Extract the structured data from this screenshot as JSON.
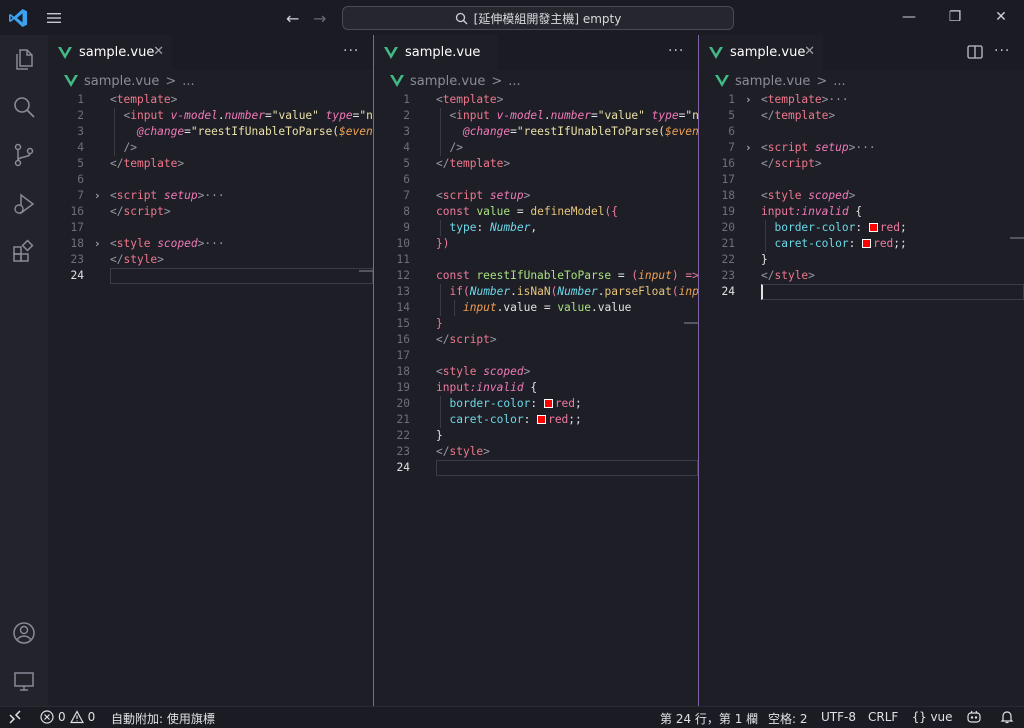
{
  "titlebar": {
    "command_center": "[延伸模組開發主機] empty",
    "back_arrow": "←",
    "forward_arrow": "→",
    "minimize": "—",
    "maximize": "❐",
    "close": "✕"
  },
  "colors": {
    "accent": "#7e63a8",
    "vue_green": "#42b883",
    "swatch_red": "#ff0000"
  },
  "activity_icons": [
    "files-icon",
    "search-icon",
    "source-control-icon",
    "run-debug-icon",
    "extensions-icon",
    "account-icon",
    "remote-explorer-icon"
  ],
  "editors": [
    {
      "tab_label": "sample.vue",
      "tab_close": "✕",
      "more": "···",
      "breadcrumb": {
        "file": "sample.vue",
        "sep": ">",
        "rest": "..."
      }
    },
    {
      "tab_label": "sample.vue",
      "more": "···",
      "breadcrumb": {
        "file": "sample.vue",
        "sep": ">",
        "rest": "..."
      }
    },
    {
      "tab_label": "sample.vue",
      "tab_close": "✕",
      "more": "···",
      "breadcrumb": {
        "file": "sample.vue",
        "sep": ">",
        "rest": "..."
      }
    }
  ],
  "statusbar": {
    "errors": "0",
    "warnings": "0",
    "auto_attach": "自動附加: 使用旗標",
    "position": "第 24 行，第 1 欄",
    "spaces": "空格: 2",
    "encoding": "UTF-8",
    "eol": "CRLF",
    "language": "vue"
  }
}
